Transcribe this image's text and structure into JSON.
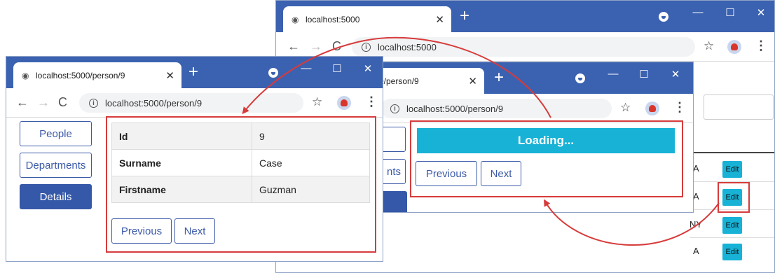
{
  "windows": {
    "back": {
      "tab_title": "localhost:5000",
      "url": "localhost:5000",
      "edit_label": "Edit",
      "row_fragments": [
        "A",
        "A",
        "NY",
        "A"
      ]
    },
    "middle": {
      "tab_title": "0/person/9",
      "url": "localhost:5000/person/9",
      "loading_text": "Loading...",
      "previous_label": "Previous",
      "next_label": "Next",
      "nav_fragment": "nts"
    },
    "front": {
      "tab_title": "localhost:5000/person/9",
      "url": "localhost:5000/person/9",
      "nav": [
        "People",
        "Departments",
        "Details"
      ],
      "table": [
        {
          "key": "Id",
          "value": "9"
        },
        {
          "key": "Surname",
          "value": "Case"
        },
        {
          "key": "Firstname",
          "value": "Guzman"
        }
      ],
      "previous_label": "Previous",
      "next_label": "Next"
    }
  },
  "icons": {
    "globe": "globe-icon",
    "close": "close-icon",
    "add": "plus-icon",
    "back": "arrow-left-icon",
    "forward": "arrow-right-icon",
    "reload": "reload-icon",
    "star": "star-icon",
    "menu": "kebab-menu-icon"
  },
  "glyphs": {
    "close": "✕",
    "plus": "+",
    "back": "←",
    "forward": "→",
    "reload": "C",
    "star": "☆",
    "menu": "⋮",
    "minimize": "—",
    "maximize": "☐",
    "info": "i"
  },
  "colors": {
    "titlebar": "#3b62b0",
    "primary": "#3658a8",
    "info": "#17b2d6",
    "annotation": "#d73b3b"
  }
}
